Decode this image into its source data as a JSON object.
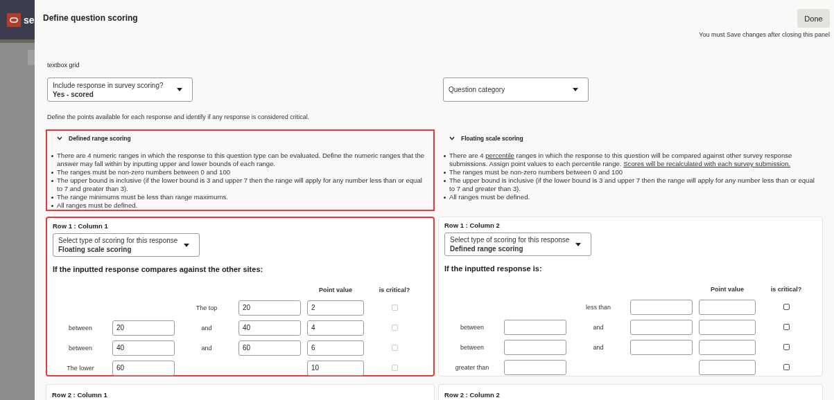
{
  "backdrop": {
    "app_name": "se"
  },
  "panel": {
    "title": "Define question scoring",
    "done_button": "Done",
    "note": "You must Save changes after closing this panel",
    "question_type": "textbox grid",
    "selects": [
      {
        "label": "Include response in survey scoring?",
        "value": "Yes - scored"
      },
      {
        "label": "Question category"
      }
    ],
    "instructions": "Define the points available for each response and identify if any response is considered critical.",
    "sections": [
      {
        "title": "Defined range scoring",
        "expanded": true,
        "highlighted": true,
        "bullets": [
          [
            {
              "text": "There are 4 numeric ranges in which the response to this question type can be evaluated. Define the numeric ranges that the answer may fall within by inputting upper and lower bounds of each range."
            }
          ],
          [
            {
              "text": "The ranges must be non-zero numbers between 0 and 100"
            }
          ],
          [
            {
              "text": "The upper bound is inclusive (if the lower bound is 3 and upper 7 then the range will apply for any number less than or equal to 7 and greater than 3)."
            }
          ],
          [
            {
              "text": "The range minimums must be less than range maximums."
            }
          ],
          [
            {
              "text": "All ranges must be defined."
            }
          ]
        ]
      },
      {
        "title": "Floating scale scoring",
        "expanded": true,
        "highlighted": false,
        "bullets": [
          [
            {
              "text": "There are 4 "
            },
            {
              "text": "percentile",
              "link": true
            },
            {
              "text": " ranges in which the response to this question will be compared against other survey response submissions. Assign point values to each percentile range. "
            },
            {
              "text": "Scores will be recalculated with each survey submission.",
              "link": true
            }
          ],
          [
            {
              "text": "The ranges must be non-zero numbers between 0 and 100"
            }
          ],
          [
            {
              "text": "The upper bound is inclusive (if the lower bound is 3 and upper 7 then the range will apply for any number less than or equal to 7 and greater than 3)."
            }
          ],
          [
            {
              "text": "All ranges must be defined."
            }
          ]
        ]
      }
    ],
    "cards": [
      {
        "title": "Row 1 : Column 1",
        "highlighted": true,
        "scoring_select": {
          "label": "Select type of scoring for this response",
          "value": "Floating scale scoring"
        },
        "heading": "If the inputted response compares against the other sites:",
        "columns": [
          "Point value",
          "is critical?"
        ],
        "rows": [
          {
            "kind": "top",
            "middle_label": "The top",
            "high": "20",
            "points": "2",
            "critical": false,
            "disabled": true
          },
          {
            "kind": "range",
            "label": "between",
            "low": "20",
            "middle_label": "and",
            "high": "40",
            "points": "4",
            "critical": false,
            "disabled": true
          },
          {
            "kind": "range",
            "label": "between",
            "low": "40",
            "middle_label": "and",
            "high": "60",
            "points": "6",
            "critical": false,
            "disabled": true
          },
          {
            "kind": "bottom",
            "label": "The lower",
            "low": "60",
            "points": "10",
            "critical": false,
            "disabled": true
          }
        ]
      },
      {
        "title": "Row 1 : Column 2",
        "highlighted": false,
        "scoring_select": {
          "label": "Select type of scoring for this response",
          "value": "Defined range scoring"
        },
        "heading": "If the inputted response is:",
        "columns": [
          "Point value",
          "is critical?"
        ],
        "rows": [
          {
            "kind": "top",
            "middle_label": "less than",
            "critical": false,
            "disabled": false
          },
          {
            "kind": "range",
            "label": "between",
            "middle_label": "and",
            "critical": false,
            "disabled": false
          },
          {
            "kind": "range",
            "label": "between",
            "middle_label": "and",
            "critical": false,
            "disabled": false
          },
          {
            "kind": "bottom",
            "label": "greater than",
            "critical": false,
            "disabled": false
          }
        ]
      }
    ],
    "more_cards": [
      "Row 2 : Column 1",
      "Row 2 : Column 2"
    ]
  }
}
